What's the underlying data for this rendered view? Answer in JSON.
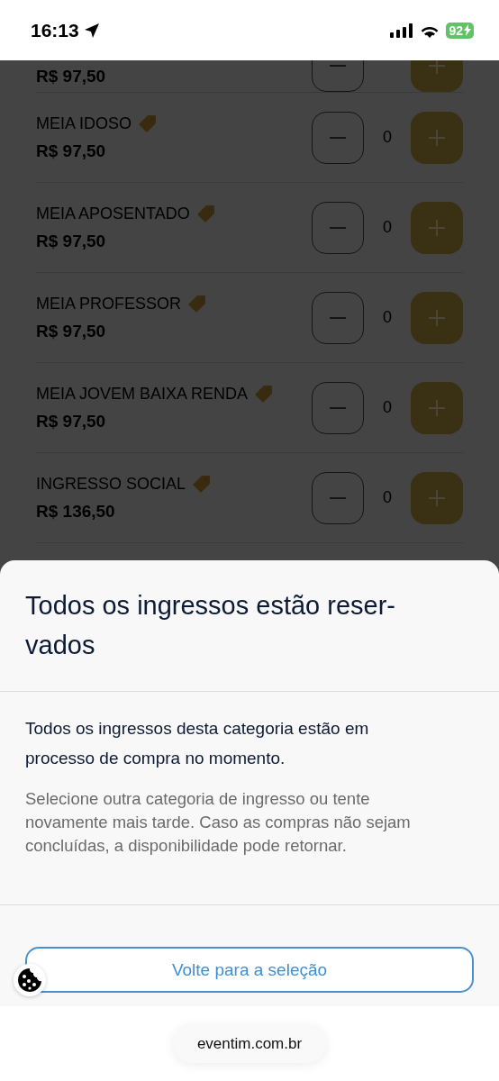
{
  "status_bar": {
    "time": "16:13",
    "battery": "92"
  },
  "tickets": [
    {
      "price": "R$ 97,50"
    },
    {
      "name": "MEIA IDOSO",
      "discount": true,
      "price": "R$ 97,50",
      "quantity": "0"
    },
    {
      "name": "MEIA APOSENTADO",
      "discount": true,
      "price": "R$ 97,50",
      "quantity": "0"
    },
    {
      "name": "MEIA PROFESSOR",
      "discount": true,
      "price": "R$ 97,50",
      "quantity": "0"
    },
    {
      "name": "MEIA JOVEM BAIXA RENDA",
      "discount": true,
      "price": "R$ 97,50",
      "quantity": "0"
    },
    {
      "name": "INGRESSO SOCIAL",
      "discount": true,
      "price": "R$ 136,50",
      "quantity": "0"
    }
  ],
  "dialog": {
    "title": "Todos os ingressos estão reser-vados",
    "message": "Todos os ingressos desta categoria estão em processo de compra no momento.",
    "hint": "Selecione outra categoria de ingresso ou tente novamente mais tarde. Caso as compras não sejam concluídas, a disponibilidade pode retornar.",
    "button": "Volte para a seleção"
  },
  "address_bar": {
    "url": "eventim.com.br"
  }
}
